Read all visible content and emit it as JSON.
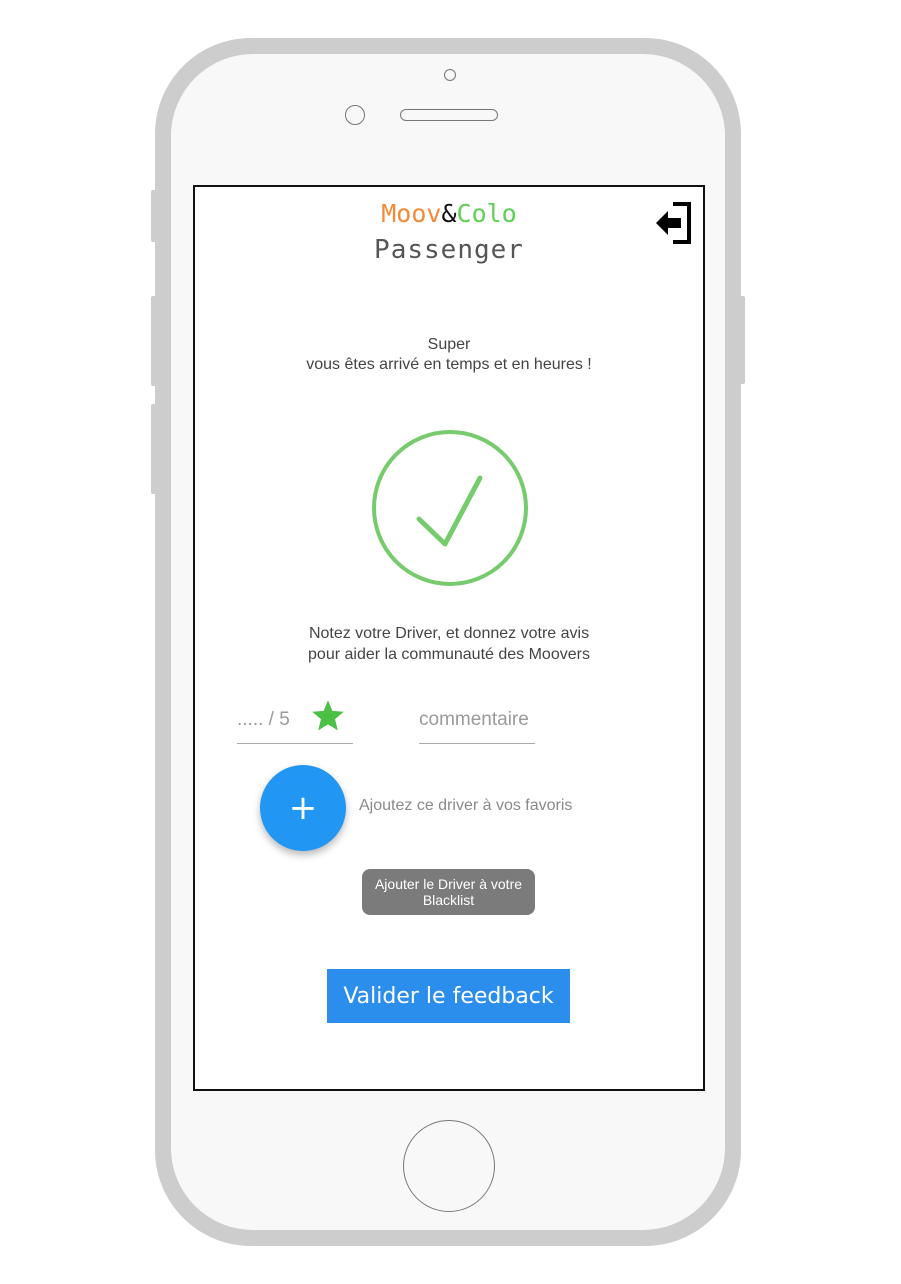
{
  "app": {
    "brand_part1": "Moov",
    "brand_part2": "&",
    "brand_part3": "Colo",
    "subtitle": "Passenger"
  },
  "message": {
    "line1": "Super",
    "line2": "vous êtes arrivé en temps et en heures !"
  },
  "prompt": {
    "line1": "Notez votre Driver, et donnez votre avis",
    "line2": "pour aider la communauté des Moovers"
  },
  "rating": {
    "placeholder": "..... / 5",
    "value": ""
  },
  "comment": {
    "placeholder": "commentaire",
    "value": ""
  },
  "favorite": {
    "button_symbol": "+",
    "label": "Ajoutez ce driver à vos favoris"
  },
  "blacklist": {
    "label": "Ajouter le Driver à votre Blacklist"
  },
  "submit": {
    "label": "Valider le feedback"
  },
  "icons": {
    "logout": "logout-icon",
    "check": "check-circle-icon",
    "star": "star-icon"
  },
  "colors": {
    "brand_orange": "#f28a3a",
    "brand_green": "#5ed053",
    "check_green": "#76cc6d",
    "star_green": "#4cbf45",
    "primary_blue": "#2196f3",
    "blacklist_gray": "#7b7b7b"
  }
}
